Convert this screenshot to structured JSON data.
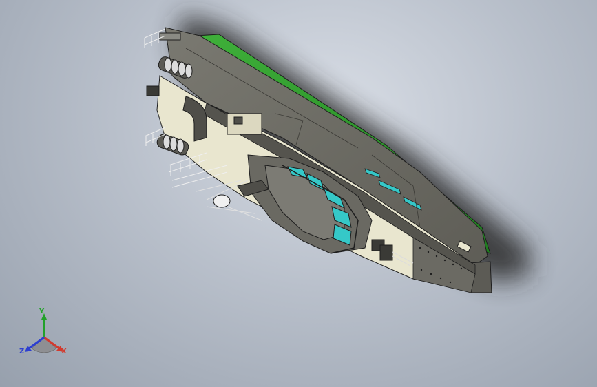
{
  "viewport": {
    "background_colors": [
      "#d9dee6",
      "#b9c0cb",
      "#97a0ad"
    ],
    "model": {
      "description_icon": "boat-hull-3d-model-icon",
      "colors": {
        "deck": "#6c6a62",
        "deck_light": "#84837b",
        "side_panel": "#e9e6cf",
        "hull_bottom": "#2f9a28",
        "glass": "#35c8c8",
        "outline": "#1e1e1e",
        "rails": "#e7e7e7"
      }
    }
  },
  "triad": {
    "y_label": "Y",
    "x_label": "X",
    "z_label": "Z",
    "colors": {
      "y": "#22a12a",
      "x": "#d23a2e",
      "z": "#2d3fd0"
    }
  }
}
